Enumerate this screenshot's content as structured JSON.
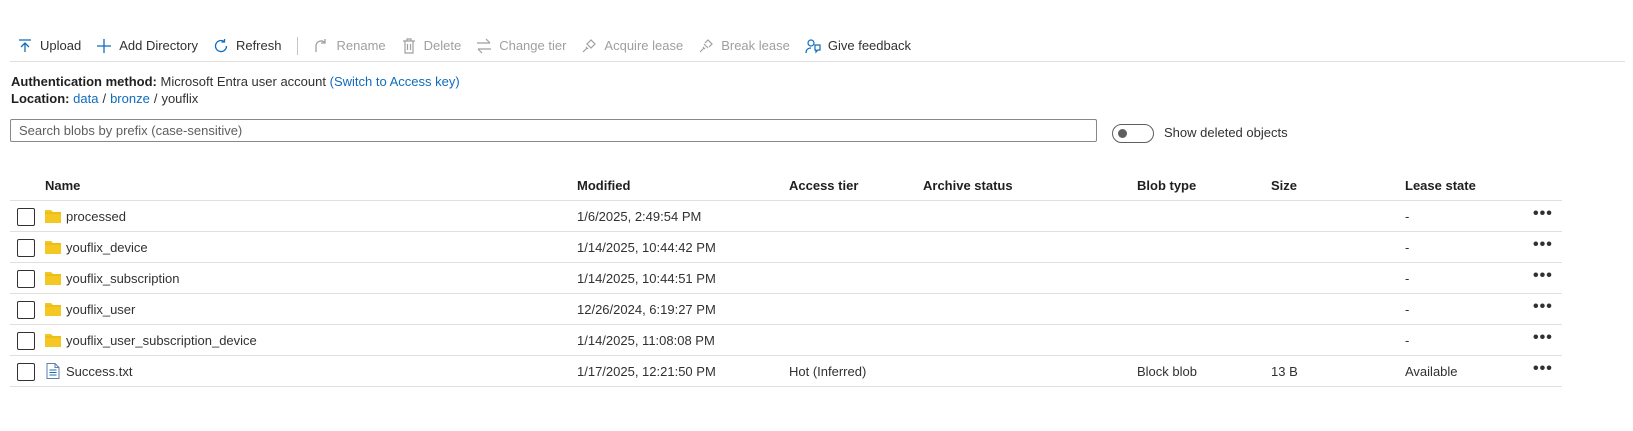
{
  "toolbar": {
    "upload": "Upload",
    "add_directory": "Add Directory",
    "refresh": "Refresh",
    "rename": "Rename",
    "delete": "Delete",
    "change_tier": "Change tier",
    "acquire_lease": "Acquire lease",
    "break_lease": "Break lease",
    "give_feedback": "Give feedback"
  },
  "auth": {
    "label": "Authentication method:",
    "value": "Microsoft Entra user account",
    "switch_link": "(Switch to Access key)"
  },
  "location": {
    "label": "Location:",
    "crumbs": [
      "data",
      "bronze",
      "youflix"
    ],
    "separator": "/"
  },
  "search": {
    "placeholder": "Search blobs by prefix (case-sensitive)"
  },
  "show_deleted": {
    "label": "Show deleted objects",
    "on": false
  },
  "table": {
    "headers": {
      "name": "Name",
      "modified": "Modified",
      "access_tier": "Access tier",
      "archive_status": "Archive status",
      "blob_type": "Blob type",
      "size": "Size",
      "lease_state": "Lease state"
    },
    "rows": [
      {
        "icon": "folder-icon",
        "name": "processed",
        "modified": "1/6/2025, 2:49:54 PM",
        "access_tier": "",
        "archive_status": "",
        "blob_type": "",
        "size": "",
        "lease_state": "-",
        "more": "•••"
      },
      {
        "icon": "folder-icon",
        "name": "youflix_device",
        "modified": "1/14/2025, 10:44:42 PM",
        "access_tier": "",
        "archive_status": "",
        "blob_type": "",
        "size": "",
        "lease_state": "-",
        "more": "•••"
      },
      {
        "icon": "folder-icon",
        "name": "youflix_subscription",
        "modified": "1/14/2025, 10:44:51 PM",
        "access_tier": "",
        "archive_status": "",
        "blob_type": "",
        "size": "",
        "lease_state": "-",
        "more": "•••"
      },
      {
        "icon": "folder-icon",
        "name": "youflix_user",
        "modified": "12/26/2024, 6:19:27 PM",
        "access_tier": "",
        "archive_status": "",
        "blob_type": "",
        "size": "",
        "lease_state": "-",
        "more": "•••"
      },
      {
        "icon": "folder-icon",
        "name": "youflix_user_subscription_device",
        "modified": "1/14/2025, 11:08:08 PM",
        "access_tier": "",
        "archive_status": "",
        "blob_type": "",
        "size": "",
        "lease_state": "-",
        "more": "•••"
      },
      {
        "icon": "file-icon",
        "name": "Success.txt",
        "modified": "1/17/2025, 12:21:50 PM",
        "access_tier": "Hot (Inferred)",
        "archive_status": "",
        "blob_type": "Block blob",
        "size": "13 B",
        "lease_state": "Available",
        "more": "•••"
      }
    ]
  },
  "colors": {
    "accent": "#0f6cbd",
    "folder": "#f4c723",
    "disabled": "#a19f9d"
  }
}
